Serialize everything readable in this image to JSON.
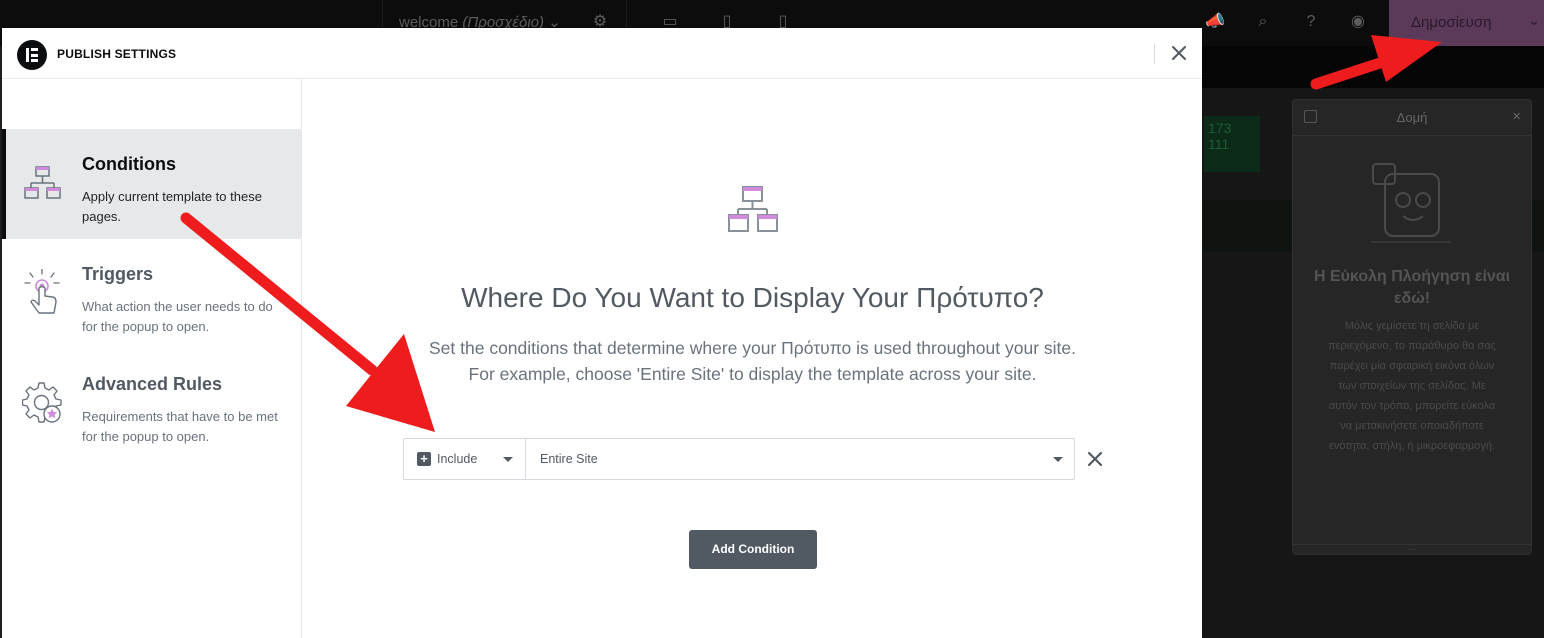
{
  "editor": {
    "doc_name": "welcome",
    "doc_status": "(Προσχέδιο)",
    "publish_label": "Δημοσίευση",
    "canvas_box_text": "173 111"
  },
  "structure_panel": {
    "title": "Δομή",
    "heading": "Η Εύκολη Πλοήγηση είναι εδώ!",
    "text": "Μόλις γεμίσετε τη σελίδα με περιεχόμενο, το παράθυρο θα σας παρέχει μία σφαιρική εικόνα όλων των στοιχείων της σελίδας. Με αυτόν τον τρόπο, μπορείτε εύκολα να μετακινήσετε οποιαδήποτε ενότητα, στήλη, ή μικροεφαρμογή.",
    "footer": "..."
  },
  "modal": {
    "title": "PUBLISH SETTINGS",
    "tabs": [
      {
        "name": "Conditions",
        "desc": "Apply current template to these pages.",
        "active": true,
        "icon": "sitemap-icon"
      },
      {
        "name": "Triggers",
        "desc": "What action the user needs to do for the popup to open.",
        "active": false,
        "icon": "tap-icon"
      },
      {
        "name": "Advanced Rules",
        "desc": "Requirements that have to be met for the popup to open.",
        "active": false,
        "icon": "gear-star-icon"
      }
    ],
    "main": {
      "headline": "Where Do You Want to Display Your Πρότυπο?",
      "subtext_line1": "Set the conditions that determine where your Πρότυπο is used throughout your site.",
      "subtext_line2": "For example, choose 'Entire Site' to display the template across your site.",
      "condition": {
        "include_label": "Include",
        "site_label": "Entire Site"
      },
      "add_button": "Add Condition"
    }
  },
  "colors": {
    "annotation_arrow": "#ee1c1c",
    "accent_icon": "#d08bdc",
    "button_bg": "#515962"
  }
}
